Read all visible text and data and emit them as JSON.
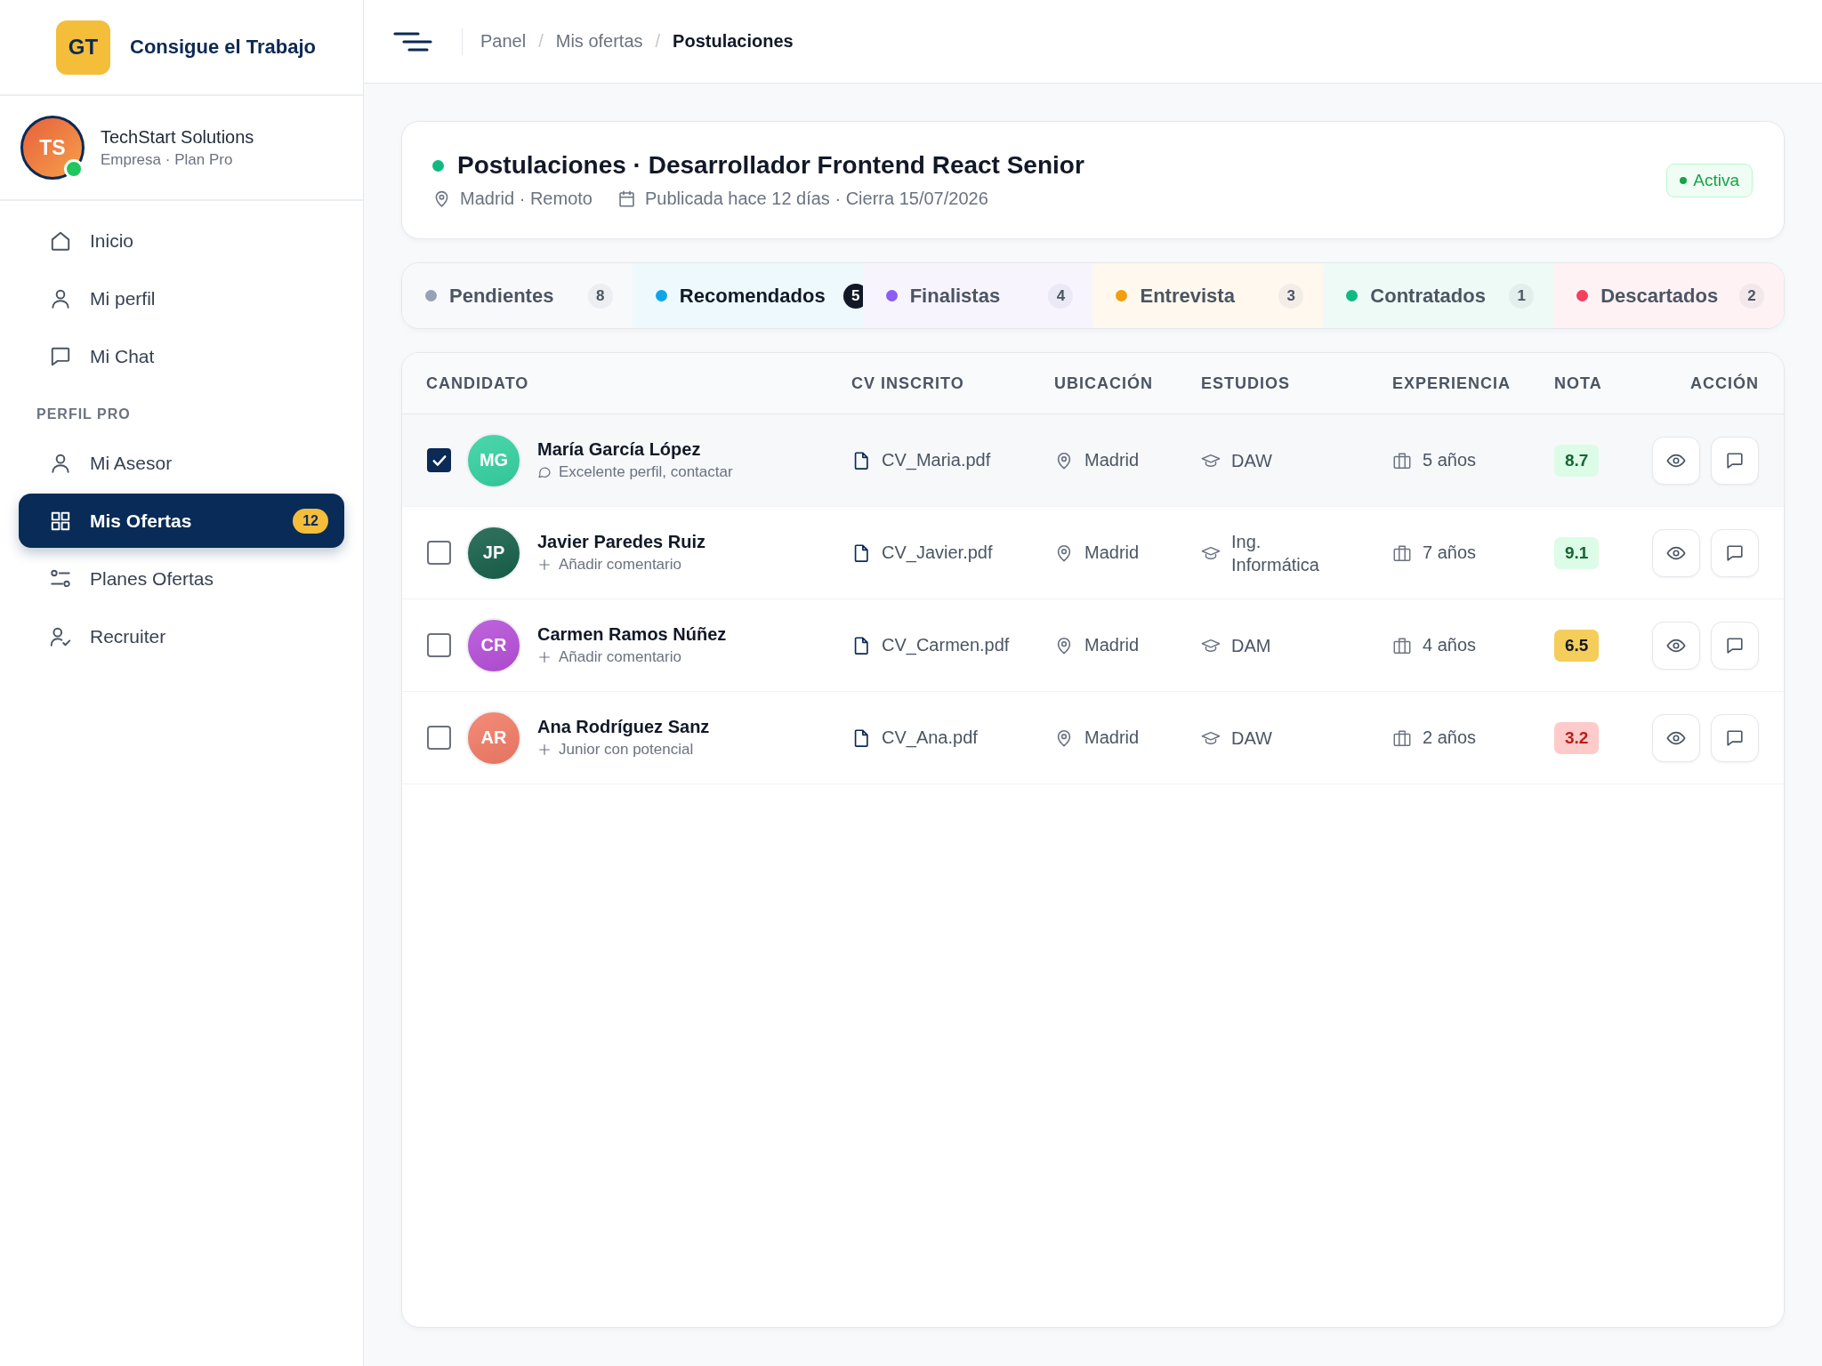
{
  "sidebar": {
    "logo": {
      "initials": "GT",
      "name": "Consigue el Trabajo"
    },
    "account": {
      "initials": "TS",
      "name": "TechStart Solutions",
      "subtitle": "Empresa · Plan Pro",
      "online": true
    },
    "nav_groups": [
      {
        "items": [
          {
            "label": "Inicio",
            "selected": false
          },
          {
            "label": "Mi perfil",
            "selected": false
          },
          {
            "label": "Mi Chat",
            "selected": false
          }
        ]
      },
      {
        "title": "PERFIL PRO",
        "items": [
          {
            "label": "Mi Asesor",
            "selected": false
          },
          {
            "label": "Mis Ofertas",
            "selected": true,
            "badge": "12"
          },
          {
            "label": "Planes Ofertas",
            "selected": false
          },
          {
            "label": "Recruiter",
            "selected": false
          }
        ]
      }
    ]
  },
  "header": {
    "breadcrumb": {
      "separator": "/",
      "items": [
        {
          "label": "Panel",
          "current": false
        },
        {
          "label": "Mis ofertas",
          "current": false
        },
        {
          "label": "Postulaciones",
          "current": true
        }
      ]
    }
  },
  "job": {
    "title": "Postulaciones · Desarrollador Frontend React Senior",
    "active": true,
    "location": "Madrid · Remoto",
    "dates": "Publicada hace 12 días · Cierra 15/07/2026",
    "status_label": "Activa"
  },
  "stages": [
    {
      "label": "Pendientes",
      "count": "8",
      "color": "#94a3b8",
      "selected": false
    },
    {
      "label": "Recomendados",
      "count": "5",
      "color": "#0ea5e9",
      "selected": true
    },
    {
      "label": "Finalistas",
      "count": "4",
      "color": "#8b5cf6",
      "selected": false
    },
    {
      "label": "Entrevista",
      "count": "3",
      "color": "#f59e0b",
      "selected": false
    },
    {
      "label": "Contratados",
      "count": "1",
      "color": "#10b981",
      "selected": false
    },
    {
      "label": "Descartados",
      "count": "2",
      "color": "#f43f5e",
      "selected": false
    }
  ],
  "table": {
    "columns": [
      "CANDIDATO",
      "CV INSCRITO",
      "UBICACIÓN",
      "ESTUDIOS",
      "EXPERIENCIA",
      "NOTA",
      "ACCIÓN"
    ],
    "rows": [
      {
        "checked": true,
        "initials": "MG",
        "color": "#34d1a0",
        "name": "María García López",
        "comment": {
          "kind": "note",
          "text": "Excelente perfil, contactar"
        },
        "cv": "CV_Maria.pdf",
        "location": "Madrid",
        "studies": "DAW",
        "experience": "5 años",
        "score": {
          "value": "8.7",
          "kind": "high"
        }
      },
      {
        "checked": false,
        "initials": "JP",
        "color": "#166049",
        "name": "Javier Paredes Ruiz",
        "comment": {
          "kind": "add",
          "text": "Añadir comentario"
        },
        "cv": "CV_Javier.pdf",
        "location": "Madrid",
        "studies": "Ing. Informática",
        "experience": "7 años",
        "score": {
          "value": "9.1",
          "kind": "high"
        }
      },
      {
        "checked": false,
        "initials": "CR",
        "color": "#b64fd8",
        "name": "Carmen Ramos Núñez",
        "comment": {
          "kind": "add",
          "text": "Añadir comentario"
        },
        "cv": "CV_Carmen.pdf",
        "location": "Madrid",
        "studies": "DAM",
        "experience": "4 años",
        "score": {
          "value": "6.5",
          "kind": "mid"
        }
      },
      {
        "checked": false,
        "initials": "AR",
        "color": "#f27b66",
        "name": "Ana Rodríguez Sanz",
        "comment": {
          "kind": "add",
          "text": "Junior con potencial"
        },
        "cv": "CV_Ana.pdf",
        "location": "Madrid",
        "studies": "DAW",
        "experience": "2 años",
        "score": {
          "value": "3.2",
          "kind": "low"
        }
      }
    ]
  }
}
